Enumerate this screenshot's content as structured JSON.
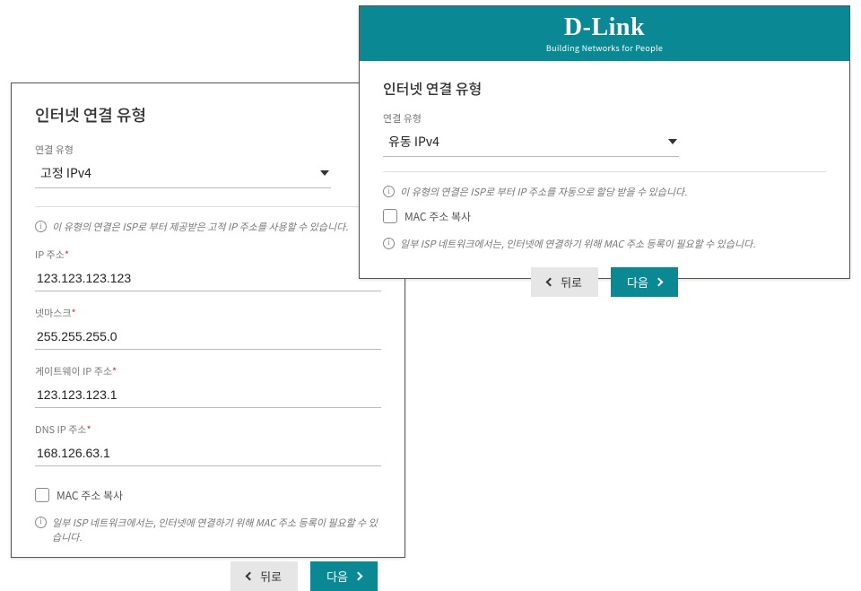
{
  "brand": {
    "name": "D-Link",
    "tagline": "Building Networks for People"
  },
  "colors": {
    "accent": "#0a8994"
  },
  "common": {
    "section_title": "인터넷 연결 유형",
    "conn_type_label": "연결 유형",
    "mac_copy_label": "MAC 주소 복사",
    "mac_hint": "일부 ISP 네트워크에서는, 인터넷에 연결하기 위해 MAC 주소 등록이 필요할 수 있습니다.",
    "back_label": "뒤로",
    "next_label": "다음"
  },
  "left": {
    "conn_type_value": "고정 IPv4",
    "hint": "이 유형의 연결은 ISP로 부터 제공받은 고적 IP 주소를 사용할 수 있습니다.",
    "fields": {
      "ip_label": "IP 주소",
      "ip_value": "123.123.123.123",
      "netmask_label": "넷마스크",
      "netmask_value": "255.255.255.0",
      "gateway_label": "게이트웨이 IP 주소",
      "gateway_value": "123.123.123.1",
      "dns_label": "DNS IP 주소",
      "dns_value": "168.126.63.1"
    }
  },
  "right": {
    "conn_type_value": "유동 IPv4",
    "hint": "이 유형의 연결은 ISP로 부터 IP 주소를 자동으로 할당 받을 수 있습니다."
  }
}
